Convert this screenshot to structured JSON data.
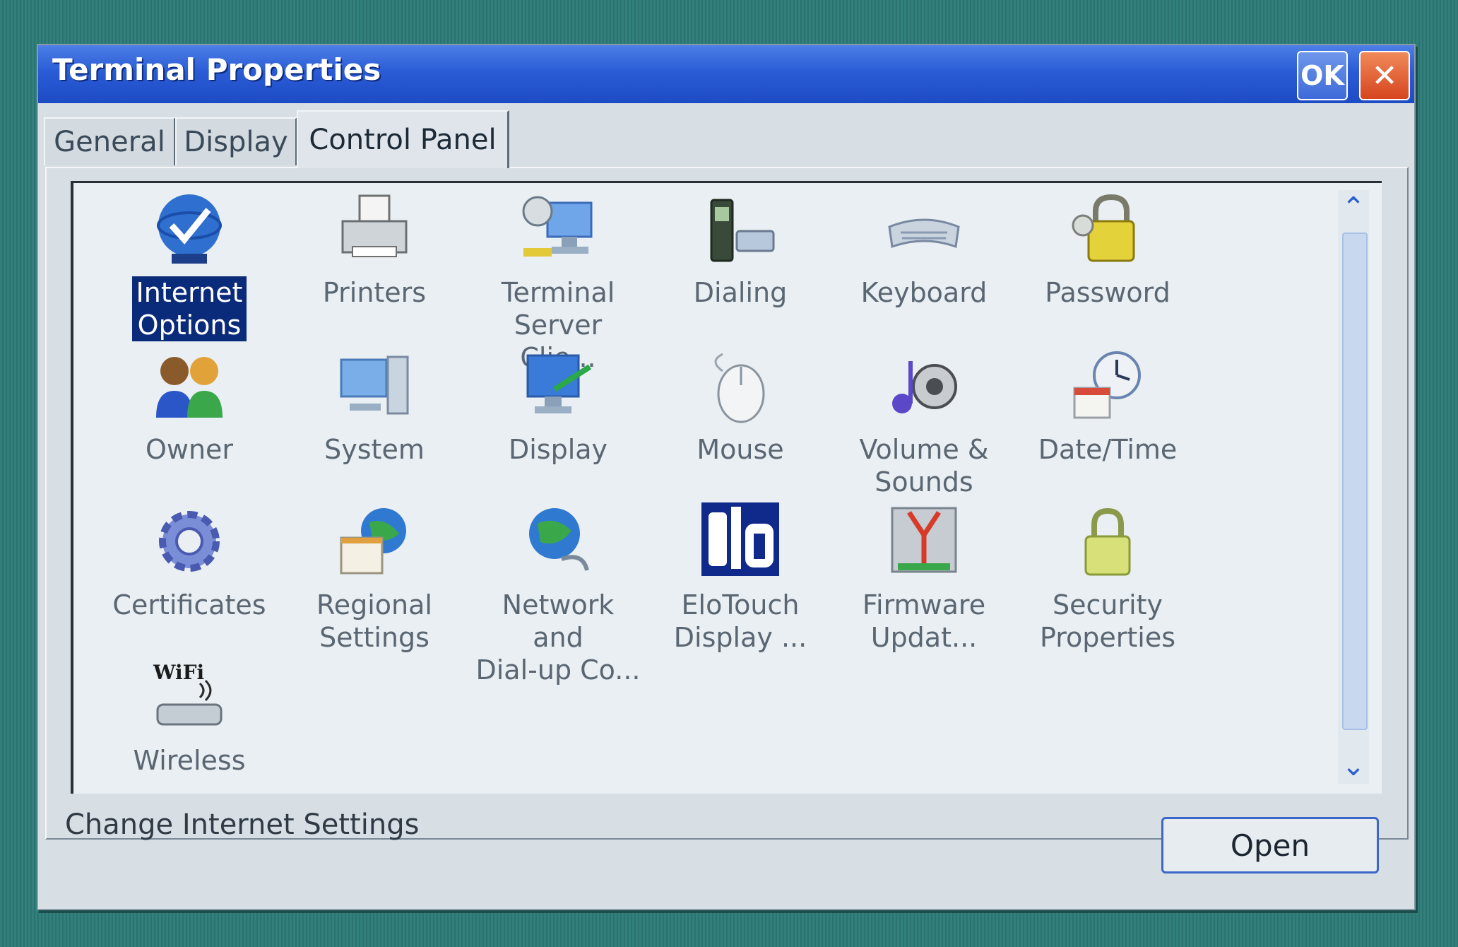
{
  "window": {
    "title": "Terminal Properties",
    "ok_label": "OK",
    "close_label": "✕"
  },
  "tabs": [
    {
      "label": "General",
      "active": false
    },
    {
      "label": "Display",
      "active": false
    },
    {
      "label": "Control Panel",
      "active": true
    }
  ],
  "items": [
    {
      "label": "Internet\nOptions",
      "icon": "globe-check-icon",
      "selected": true
    },
    {
      "label": "Printers",
      "icon": "printer-icon",
      "selected": false
    },
    {
      "label": "Terminal\nServer Clie...",
      "icon": "terminal-server-icon",
      "selected": false
    },
    {
      "label": "Dialing",
      "icon": "phone-icon",
      "selected": false
    },
    {
      "label": "Keyboard",
      "icon": "keyboard-icon",
      "selected": false
    },
    {
      "label": "Password",
      "icon": "lock-icon",
      "selected": false
    },
    {
      "label": "Owner",
      "icon": "users-icon",
      "selected": false
    },
    {
      "label": "System",
      "icon": "computer-icon",
      "selected": false
    },
    {
      "label": "Display",
      "icon": "display-icon",
      "selected": false
    },
    {
      "label": "Mouse",
      "icon": "mouse-icon",
      "selected": false
    },
    {
      "label": "Volume &\nSounds",
      "icon": "speaker-icon",
      "selected": false
    },
    {
      "label": "Date/Time",
      "icon": "clock-icon",
      "selected": false
    },
    {
      "label": "Certificates",
      "icon": "gear-icon",
      "selected": false
    },
    {
      "label": "Regional\nSettings",
      "icon": "globe-icon",
      "selected": false
    },
    {
      "label": "Network and\nDial-up Co...",
      "icon": "network-icon",
      "selected": false
    },
    {
      "label": "EloTouch\nDisplay ...",
      "icon": "elo-logo-icon",
      "selected": false
    },
    {
      "label": "Firmware\nUpdat...",
      "icon": "firmware-icon",
      "selected": false
    },
    {
      "label": "Security\nProperties",
      "icon": "security-lock-icon",
      "selected": false
    },
    {
      "label": "Wireless",
      "icon": "wifi-icon",
      "selected": false
    }
  ],
  "status": {
    "description": "Change Internet Settings"
  },
  "buttons": {
    "open_label": "Open"
  },
  "scrollbar": {
    "up_glyph": "⌃",
    "down_glyph": "⌄"
  },
  "colors": {
    "titlebar": "#2a5cd6",
    "selection": "#0a2a7a",
    "close": "#d6451e"
  }
}
